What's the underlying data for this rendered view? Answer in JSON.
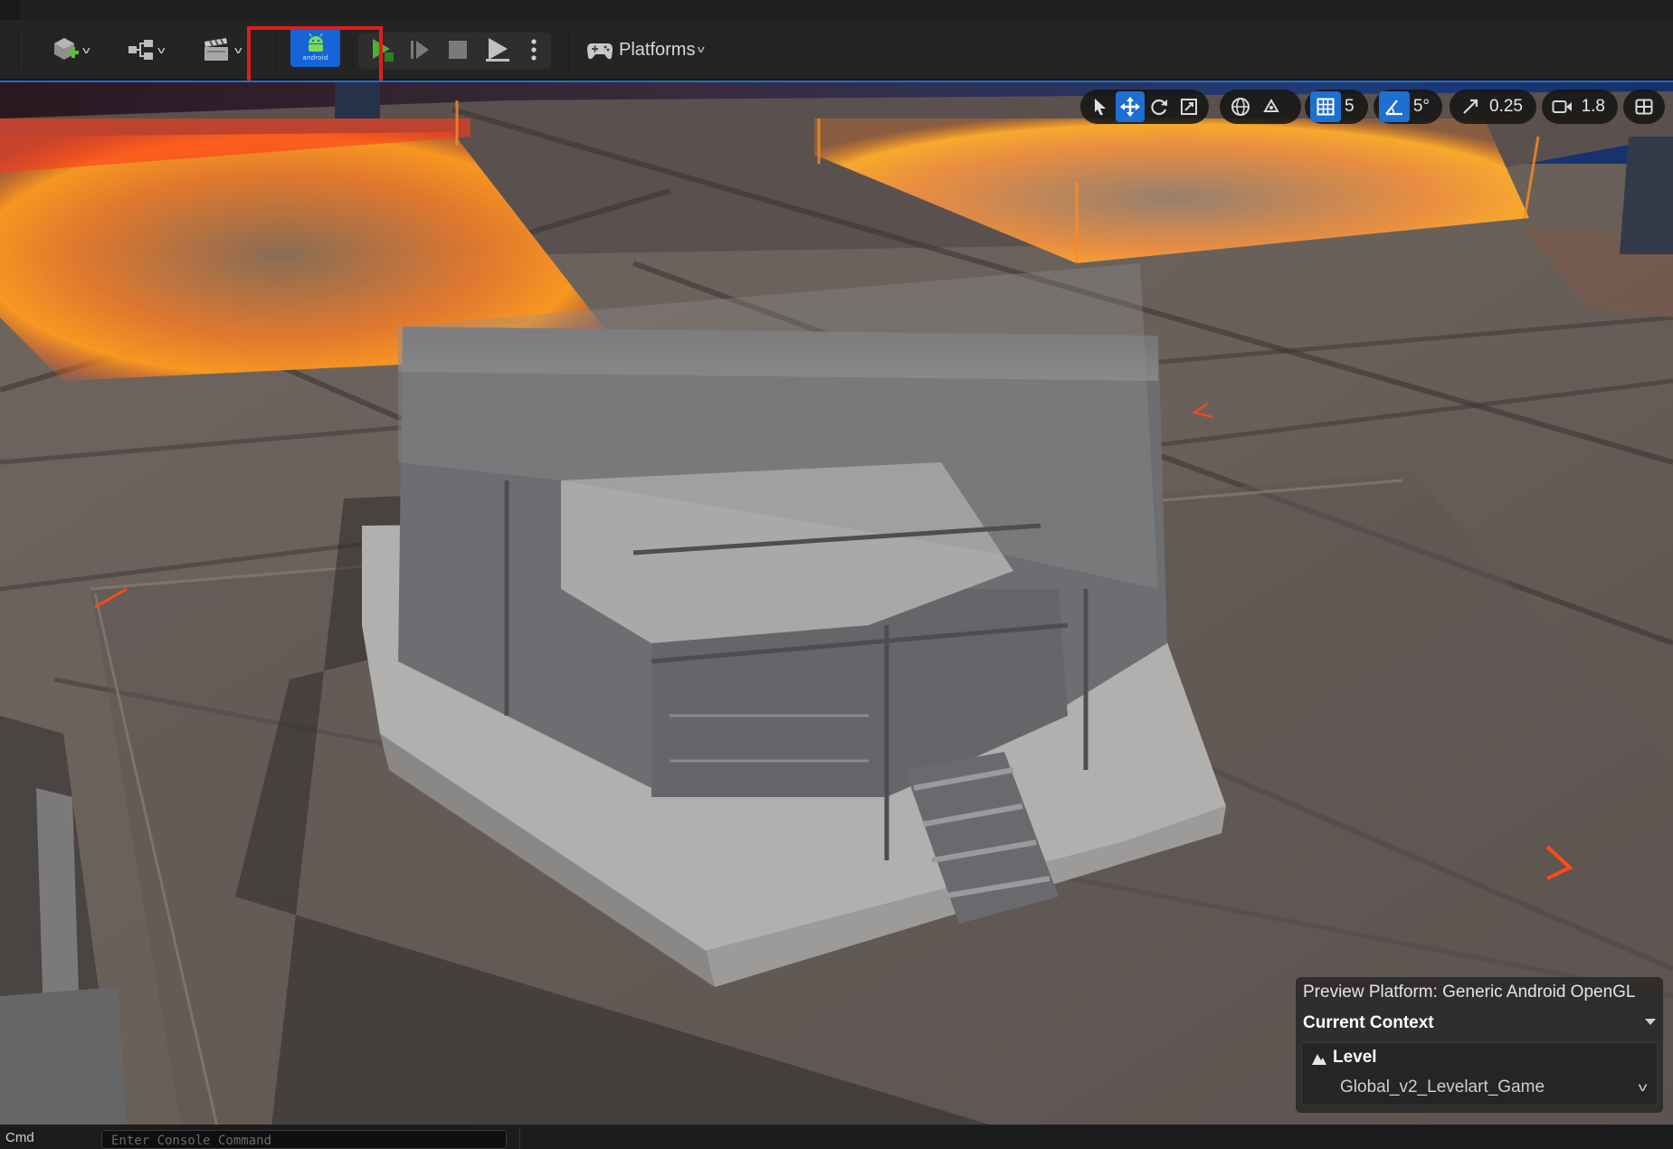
{
  "toolbar": {
    "platforms_label": "Platforms",
    "android_label": "android"
  },
  "viewport_toolbar": {
    "grid_snap_value": "5",
    "rotation_snap_value": "5°",
    "scale_snap_value": "0.25",
    "camera_speed_value": "1.8"
  },
  "preview_panel": {
    "preview_platform": "Preview Platform:  Generic Android OpenGL",
    "current_context_label": "Current Context",
    "level_label": "Level",
    "level_value": "Global_v2_Levelart_Game"
  },
  "console": {
    "cmd_label": "Cmd",
    "placeholder": "Enter Console Command"
  },
  "colors": {
    "accent": "#1d6fd0",
    "android_button": "#1565d8",
    "highlight": "#e21c1c",
    "play_green": "#4caf32"
  }
}
